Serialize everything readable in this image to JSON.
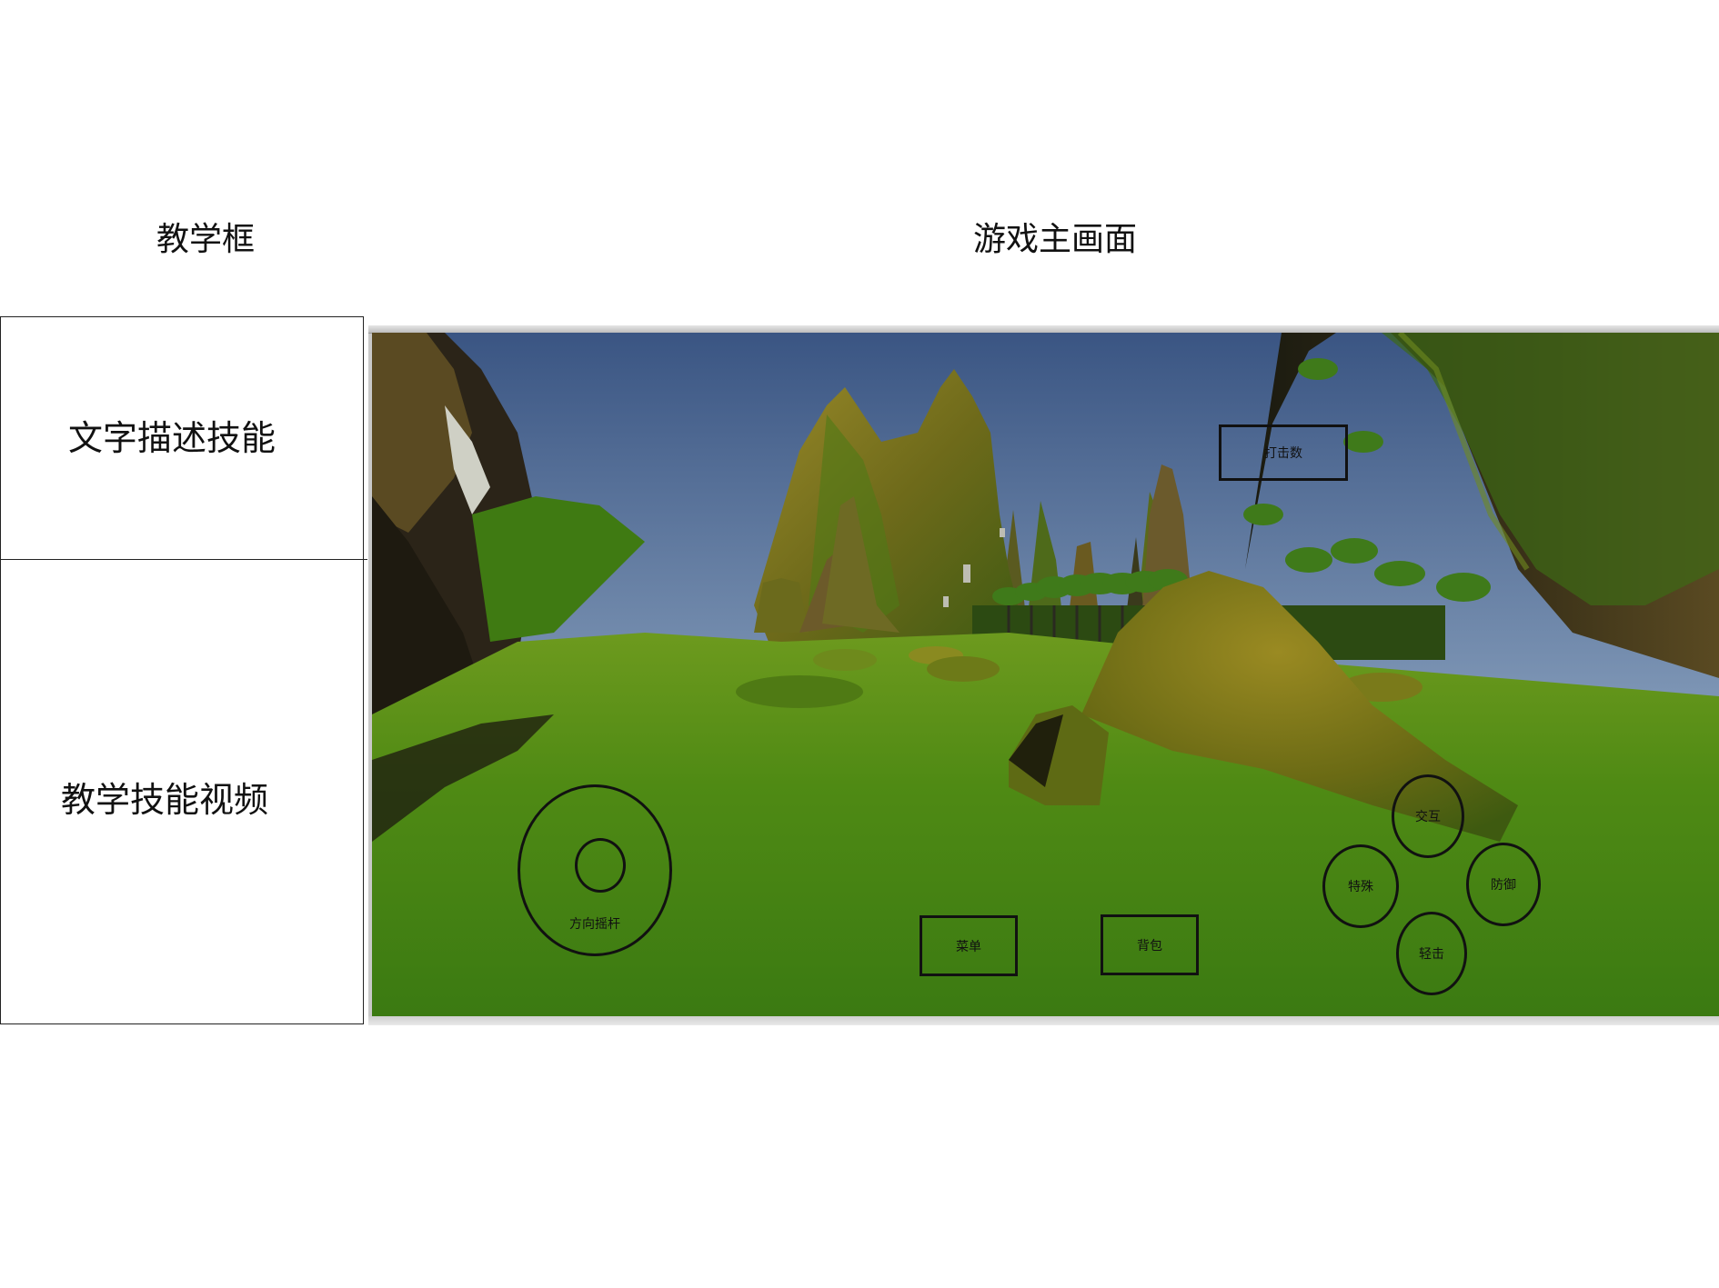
{
  "headings": {
    "tutorial": "教学框",
    "game": "游戏主画面"
  },
  "tutorial_panel": {
    "text_description": "文字描述技能",
    "video": "教学技能视频"
  },
  "hud": {
    "hit_count": "打击数",
    "menu": "菜单",
    "bag": "背包",
    "joystick": "方向摇杆",
    "interact": "交互",
    "special": "特殊",
    "defend": "防御",
    "light_hit": "轻击"
  },
  "scene": {
    "sky_top": "#3f5a86",
    "sky_horizon": "#b9c8d8",
    "grass_dark": "#3f7d12",
    "grass_light": "#6aa51f",
    "mountain_dark": "#2e2a16",
    "mountain_olive": "#6f6a17"
  }
}
